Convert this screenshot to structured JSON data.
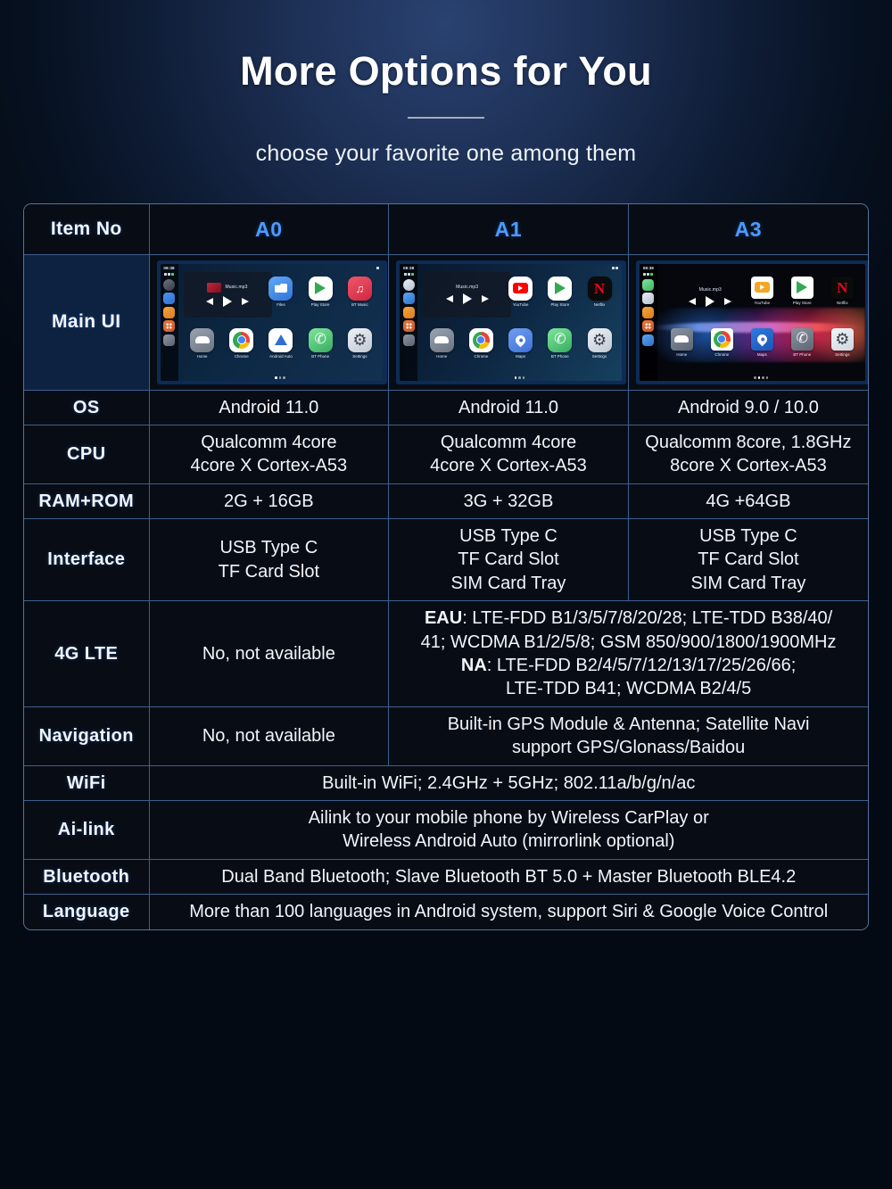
{
  "header": {
    "title": "More Options for You",
    "subtitle": "choose your favorite one among them"
  },
  "table": {
    "columns": [
      "Item No",
      "A0",
      "A1",
      "A3"
    ],
    "rows": [
      {
        "label": "Main UI",
        "type": "ui-thumbnails",
        "thumbs": [
          {
            "model": "A0",
            "clock": "08:38",
            "track": "Music.mp3",
            "apps_row1": [
              "Files",
              "Play Store",
              "BT Music"
            ],
            "apps_row2": [
              "Home",
              "Chrome",
              "Android Auto",
              "BT Phone",
              "Settings"
            ]
          },
          {
            "model": "A1",
            "clock": "08:38",
            "track": "Music.mp3",
            "apps_row1": [
              "YouTube",
              "Play Store",
              "Netflix"
            ],
            "apps_row2": [
              "Home",
              "Chrome",
              "Maps",
              "BT Phone",
              "Settings"
            ]
          },
          {
            "model": "A3",
            "clock": "08:38",
            "track": "Music.mp3",
            "apps_row1": [
              "YouTube",
              "Play Store",
              "Netflix"
            ],
            "apps_row2": [
              "Home",
              "Chrome",
              "Maps",
              "BT Phone",
              "Settings"
            ]
          }
        ]
      },
      {
        "label": "OS",
        "type": "three",
        "a0": "Android 11.0",
        "a1": "Android 11.0",
        "a3": "Android 9.0 / 10.0"
      },
      {
        "label": "CPU",
        "type": "three",
        "a0": "Qualcomm 4core\n4core X Cortex-A53",
        "a1": "Qualcomm 4core\n4core X Cortex-A53",
        "a3": "Qualcomm 8core, 1.8GHz\n8core X Cortex-A53"
      },
      {
        "label": "RAM+ROM",
        "type": "three",
        "a0": "2G + 16GB",
        "a1": "3G + 32GB",
        "a3": "4G +64GB"
      },
      {
        "label": "Interface",
        "type": "three",
        "a0": "USB Type C\nTF Card Slot",
        "a1": "USB Type C\nTF Card Slot\nSIM Card Tray",
        "a3": "USB Type C\nTF Card Slot\nSIM Card Tray"
      },
      {
        "label": "4G LTE",
        "type": "split",
        "a0": "No, not available",
        "merged_rich": [
          {
            "bold": "EAU",
            "text": ": LTE-FDD B1/3/5/7/8/20/28; LTE-TDD B38/40/"
          },
          {
            "bold": "",
            "text": "41; WCDMA B1/2/5/8; GSM 850/900/1800/1900MHz"
          },
          {
            "bold": "NA",
            "text": ": LTE-FDD B2/4/5/7/12/13/17/25/26/66;"
          },
          {
            "bold": "",
            "text": "LTE-TDD B41; WCDMA B2/4/5"
          }
        ]
      },
      {
        "label": "Navigation",
        "type": "split",
        "a0": "No, not available",
        "merged": "Built-in GPS Module & Antenna; Satellite Navi\nsupport GPS/Glonass/Baidou"
      },
      {
        "label": "WiFi",
        "type": "full",
        "value": "Built-in WiFi; 2.4GHz + 5GHz; 802.11a/b/g/n/ac"
      },
      {
        "label": "Ai-link",
        "type": "full",
        "value": "Ailink to your mobile phone by Wireless CarPlay or\nWireless Android Auto (mirrorlink optional)"
      },
      {
        "label": "Bluetooth",
        "type": "full",
        "value": "Dual Band Bluetooth; Slave Bluetooth BT 5.0 + Master Bluetooth BLE4.2"
      },
      {
        "label": "Language",
        "type": "full",
        "value": "More than 100 languages in Android system, support Siri & Google Voice Control"
      }
    ]
  },
  "colors": {
    "accent_blue": "#4d9aff",
    "border": "#3f5f8e",
    "cell_bg": "#080d15",
    "ui_row_bg": "#0d2240",
    "text": "#f2f5fa"
  }
}
